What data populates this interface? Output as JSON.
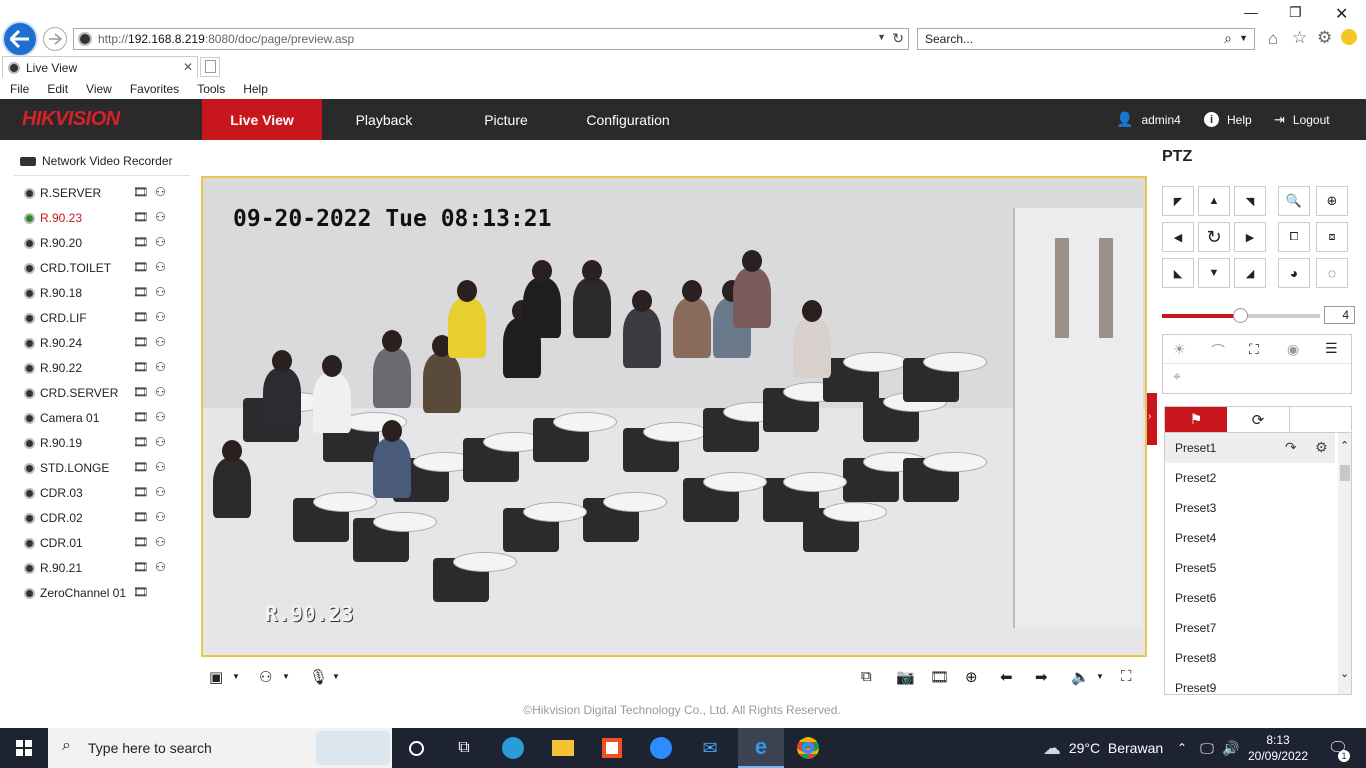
{
  "browser": {
    "url_prefix": "http://",
    "url_host": "192.168.8.219",
    "url_rest": ":8080/doc/page/preview.asp",
    "search_placeholder": "Search...",
    "tab_title": "Live View",
    "menu": [
      "File",
      "Edit",
      "View",
      "Favorites",
      "Tools",
      "Help"
    ]
  },
  "header": {
    "logo": "HIKVISION",
    "nav": [
      "Live View",
      "Playback",
      "Picture",
      "Configuration"
    ],
    "active_nav": "Live View",
    "user": "admin4",
    "help": "Help",
    "logout": "Logout"
  },
  "sidebar": {
    "title": "Network Video Recorder",
    "cameras": [
      "R.SERVER",
      "R.90.23",
      "R.90.20",
      "CRD.TOILET",
      "R.90.18",
      "CRD.LIF",
      "R.90.24",
      "R.90.22",
      "CRD.SERVER",
      "Camera 01",
      "R.90.19",
      "STD.LONGE",
      "CDR.03",
      "CDR.02",
      "CDR.01",
      "R.90.21",
      "ZeroChannel 01"
    ],
    "selected_camera": "R.90.23"
  },
  "video": {
    "timestamp": "09-20-2022 Tue 08:13:21",
    "channel_name": "R.90.23"
  },
  "footer": {
    "copyright": "©Hikvision Digital Technology Co., Ltd. All Rights Reserved."
  },
  "ptz": {
    "title": "PTZ",
    "speed": "4",
    "speed_fraction": 0.5,
    "presets": [
      "Preset1",
      "Preset2",
      "Preset3",
      "Preset4",
      "Preset5",
      "Preset6",
      "Preset7",
      "Preset8",
      "Preset9"
    ]
  },
  "taskbar": {
    "search_placeholder": "Type here to search",
    "weather": "29°C  Berawan",
    "time": "8:13",
    "date": "20/09/2022",
    "notifications": "1"
  },
  "colors": {
    "brand_red": "#c8161d",
    "header_bg": "#2a2a2a",
    "video_border": "#e8c848"
  }
}
